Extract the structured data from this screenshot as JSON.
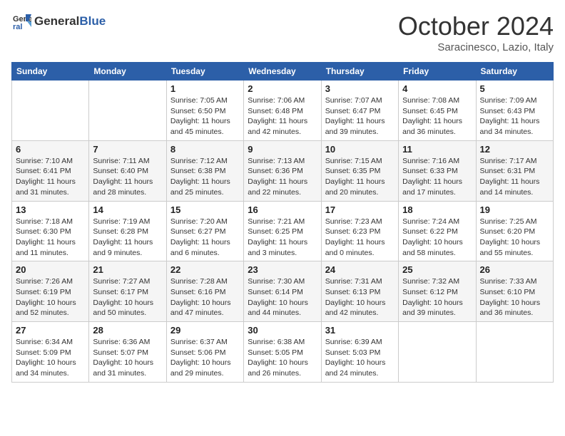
{
  "header": {
    "logo_general": "General",
    "logo_blue": "Blue",
    "title": "October 2024",
    "subtitle": "Saracinesco, Lazio, Italy"
  },
  "days_of_week": [
    "Sunday",
    "Monday",
    "Tuesday",
    "Wednesday",
    "Thursday",
    "Friday",
    "Saturday"
  ],
  "weeks": [
    [
      {
        "day": "",
        "info": ""
      },
      {
        "day": "",
        "info": ""
      },
      {
        "day": "1",
        "info": "Sunrise: 7:05 AM\nSunset: 6:50 PM\nDaylight: 11 hours and 45 minutes."
      },
      {
        "day": "2",
        "info": "Sunrise: 7:06 AM\nSunset: 6:48 PM\nDaylight: 11 hours and 42 minutes."
      },
      {
        "day": "3",
        "info": "Sunrise: 7:07 AM\nSunset: 6:47 PM\nDaylight: 11 hours and 39 minutes."
      },
      {
        "day": "4",
        "info": "Sunrise: 7:08 AM\nSunset: 6:45 PM\nDaylight: 11 hours and 36 minutes."
      },
      {
        "day": "5",
        "info": "Sunrise: 7:09 AM\nSunset: 6:43 PM\nDaylight: 11 hours and 34 minutes."
      }
    ],
    [
      {
        "day": "6",
        "info": "Sunrise: 7:10 AM\nSunset: 6:41 PM\nDaylight: 11 hours and 31 minutes."
      },
      {
        "day": "7",
        "info": "Sunrise: 7:11 AM\nSunset: 6:40 PM\nDaylight: 11 hours and 28 minutes."
      },
      {
        "day": "8",
        "info": "Sunrise: 7:12 AM\nSunset: 6:38 PM\nDaylight: 11 hours and 25 minutes."
      },
      {
        "day": "9",
        "info": "Sunrise: 7:13 AM\nSunset: 6:36 PM\nDaylight: 11 hours and 22 minutes."
      },
      {
        "day": "10",
        "info": "Sunrise: 7:15 AM\nSunset: 6:35 PM\nDaylight: 11 hours and 20 minutes."
      },
      {
        "day": "11",
        "info": "Sunrise: 7:16 AM\nSunset: 6:33 PM\nDaylight: 11 hours and 17 minutes."
      },
      {
        "day": "12",
        "info": "Sunrise: 7:17 AM\nSunset: 6:31 PM\nDaylight: 11 hours and 14 minutes."
      }
    ],
    [
      {
        "day": "13",
        "info": "Sunrise: 7:18 AM\nSunset: 6:30 PM\nDaylight: 11 hours and 11 minutes."
      },
      {
        "day": "14",
        "info": "Sunrise: 7:19 AM\nSunset: 6:28 PM\nDaylight: 11 hours and 9 minutes."
      },
      {
        "day": "15",
        "info": "Sunrise: 7:20 AM\nSunset: 6:27 PM\nDaylight: 11 hours and 6 minutes."
      },
      {
        "day": "16",
        "info": "Sunrise: 7:21 AM\nSunset: 6:25 PM\nDaylight: 11 hours and 3 minutes."
      },
      {
        "day": "17",
        "info": "Sunrise: 7:23 AM\nSunset: 6:23 PM\nDaylight: 11 hours and 0 minutes."
      },
      {
        "day": "18",
        "info": "Sunrise: 7:24 AM\nSunset: 6:22 PM\nDaylight: 10 hours and 58 minutes."
      },
      {
        "day": "19",
        "info": "Sunrise: 7:25 AM\nSunset: 6:20 PM\nDaylight: 10 hours and 55 minutes."
      }
    ],
    [
      {
        "day": "20",
        "info": "Sunrise: 7:26 AM\nSunset: 6:19 PM\nDaylight: 10 hours and 52 minutes."
      },
      {
        "day": "21",
        "info": "Sunrise: 7:27 AM\nSunset: 6:17 PM\nDaylight: 10 hours and 50 minutes."
      },
      {
        "day": "22",
        "info": "Sunrise: 7:28 AM\nSunset: 6:16 PM\nDaylight: 10 hours and 47 minutes."
      },
      {
        "day": "23",
        "info": "Sunrise: 7:30 AM\nSunset: 6:14 PM\nDaylight: 10 hours and 44 minutes."
      },
      {
        "day": "24",
        "info": "Sunrise: 7:31 AM\nSunset: 6:13 PM\nDaylight: 10 hours and 42 minutes."
      },
      {
        "day": "25",
        "info": "Sunrise: 7:32 AM\nSunset: 6:12 PM\nDaylight: 10 hours and 39 minutes."
      },
      {
        "day": "26",
        "info": "Sunrise: 7:33 AM\nSunset: 6:10 PM\nDaylight: 10 hours and 36 minutes."
      }
    ],
    [
      {
        "day": "27",
        "info": "Sunrise: 6:34 AM\nSunset: 5:09 PM\nDaylight: 10 hours and 34 minutes."
      },
      {
        "day": "28",
        "info": "Sunrise: 6:36 AM\nSunset: 5:07 PM\nDaylight: 10 hours and 31 minutes."
      },
      {
        "day": "29",
        "info": "Sunrise: 6:37 AM\nSunset: 5:06 PM\nDaylight: 10 hours and 29 minutes."
      },
      {
        "day": "30",
        "info": "Sunrise: 6:38 AM\nSunset: 5:05 PM\nDaylight: 10 hours and 26 minutes."
      },
      {
        "day": "31",
        "info": "Sunrise: 6:39 AM\nSunset: 5:03 PM\nDaylight: 10 hours and 24 minutes."
      },
      {
        "day": "",
        "info": ""
      },
      {
        "day": "",
        "info": ""
      }
    ]
  ]
}
